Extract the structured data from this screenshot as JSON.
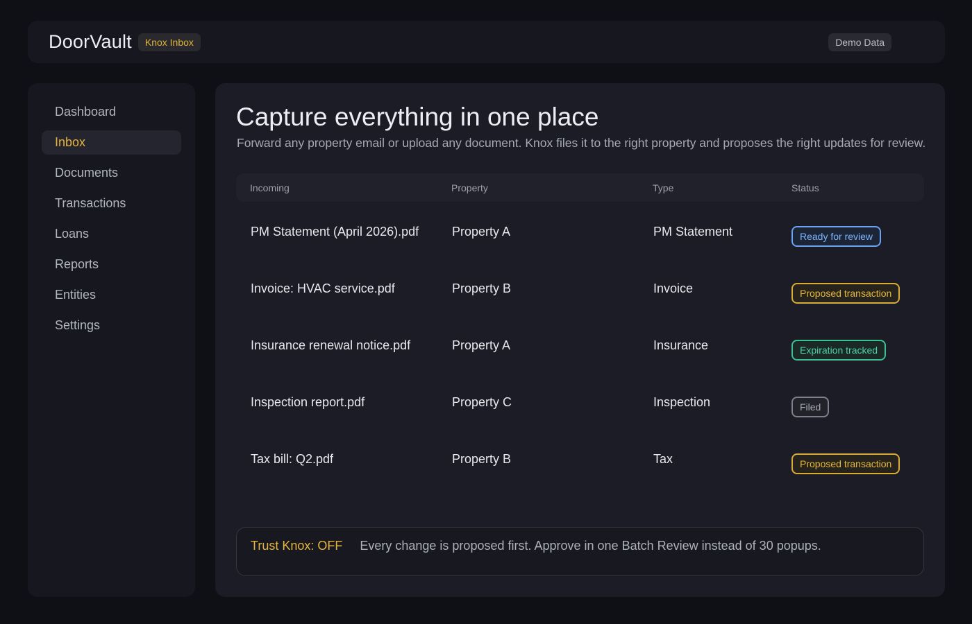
{
  "header": {
    "brand": "DoorVault",
    "brand_badge": "Knox Inbox",
    "demo_badge": "Demo Data"
  },
  "sidebar": {
    "items": [
      {
        "label": "Dashboard",
        "active": false
      },
      {
        "label": "Inbox",
        "active": true
      },
      {
        "label": "Documents",
        "active": false
      },
      {
        "label": "Transactions",
        "active": false
      },
      {
        "label": "Loans",
        "active": false
      },
      {
        "label": "Reports",
        "active": false
      },
      {
        "label": "Entities",
        "active": false
      },
      {
        "label": "Settings",
        "active": false
      }
    ]
  },
  "main": {
    "title": "Capture everything in one place",
    "subtitle": "Forward any property email or upload any document. Knox files it to the right property and proposes the right updates for review.",
    "table": {
      "headers": [
        "Incoming",
        "Property",
        "Type",
        "Status"
      ],
      "rows": [
        {
          "incoming": "PM Statement (April 2026).pdf",
          "property": "Property A",
          "type": "PM Statement",
          "status": "Ready for review",
          "status_color": "#6aa3f5"
        },
        {
          "incoming": "Invoice: HVAC service.pdf",
          "property": "Property B",
          "type": "Invoice",
          "status": "Proposed transaction",
          "status_color": "#d9ac38"
        },
        {
          "incoming": "Insurance renewal notice.pdf",
          "property": "Property A",
          "type": "Insurance",
          "status": "Expiration tracked",
          "status_color": "#3dc091"
        },
        {
          "incoming": "Inspection report.pdf",
          "property": "Property C",
          "type": "Inspection",
          "status": "Filed",
          "status_color": "#7d808a"
        },
        {
          "incoming": "Tax bill: Q2.pdf",
          "property": "Property B",
          "type": "Tax",
          "status": "Proposed transaction",
          "status_color": "#d9ac38"
        }
      ]
    },
    "trust": {
      "label": "Trust Knox: OFF",
      "text": "Every change is proposed first. Approve in one Batch Review instead of 30 popups."
    }
  },
  "colors": {
    "accent": "#e5b43c",
    "background": "#0f1016",
    "panel": "#17181f"
  }
}
